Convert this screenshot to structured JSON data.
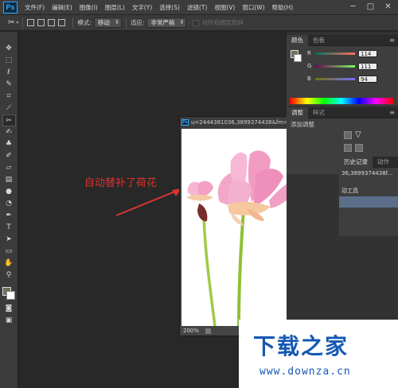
{
  "app": {
    "logo": "Ps"
  },
  "menubar": {
    "items": [
      "文件(F)",
      "编辑(E)",
      "图像(I)",
      "图层(L)",
      "文字(Y)",
      "选择(S)",
      "滤镜(T)",
      "视图(V)",
      "窗口(W)",
      "帮助(H)"
    ],
    "window_controls": [
      "─",
      "□",
      "✕"
    ]
  },
  "options": {
    "mode_label": "模式:",
    "mode_value": "移动",
    "adapt_label": "适应:",
    "adapt_value": "非常严格",
    "sample_all_label": "对所有图层取样"
  },
  "toolbar": {
    "tools": [
      "move-tool",
      "marquee-tool",
      "lasso-tool",
      "quick-select-tool",
      "crop-tool",
      "eyedropper-tool",
      "content-aware-move-tool",
      "brush-tool",
      "clone-stamp-tool",
      "history-brush-tool",
      "eraser-tool",
      "gradient-tool",
      "blur-tool",
      "dodge-tool",
      "pen-tool",
      "type-tool",
      "path-select-tool",
      "shape-tool",
      "hand-tool",
      "zoom-tool"
    ],
    "foreground_color": "#726f5b",
    "background_color": "#ffffff"
  },
  "document": {
    "title": "u=2444381036,3899374438&fm=21...",
    "zoom": "200%",
    "controls": [
      "▬",
      "□",
      "✕"
    ]
  },
  "annotation": {
    "text": "自动替补了荷花",
    "color": "#d8352f"
  },
  "panels": {
    "color_tabs": [
      "颜色",
      "色板"
    ],
    "rgb": [
      {
        "label": "R",
        "value": "114"
      },
      {
        "label": "G",
        "value": "111"
      },
      {
        "label": "B",
        "value": "94"
      }
    ],
    "adjust_tabs": [
      "调整",
      "样式"
    ],
    "adjust_title": "添加调整",
    "history_tabs": [
      "历史记录",
      "动作"
    ],
    "history_items": [
      "36,3899374438f...",
      "动工具",
      ""
    ]
  },
  "watermark": {
    "title": "下载之家",
    "url": "www.downza.cn",
    "color": "#1458b4"
  }
}
